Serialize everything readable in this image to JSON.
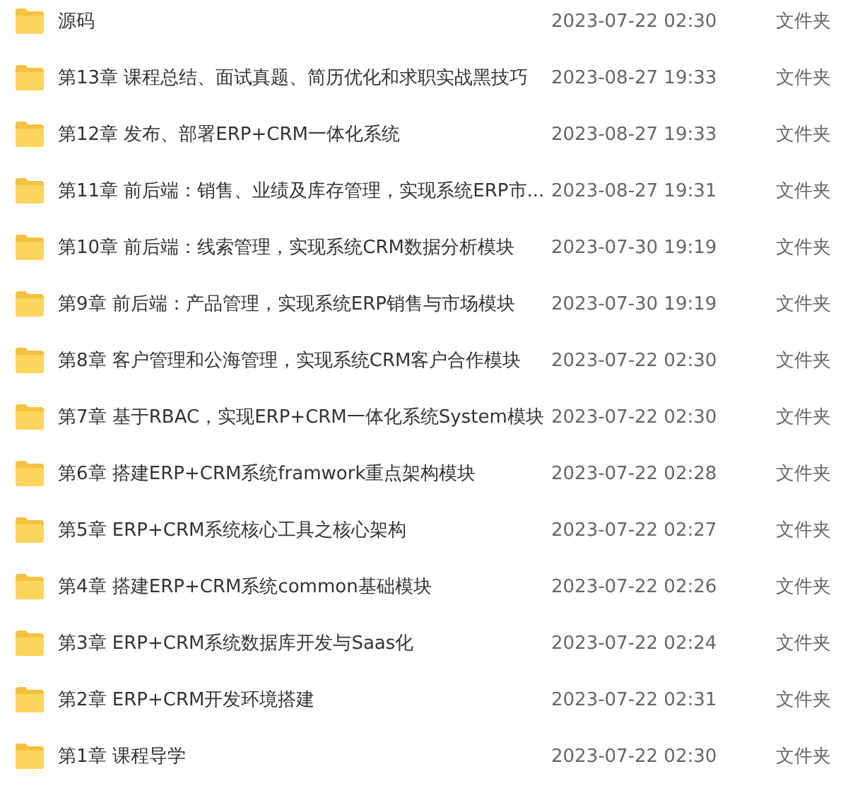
{
  "rows": [
    {
      "name": "源码",
      "modified": "2023-07-22 02:30",
      "type": "文件夹"
    },
    {
      "name": "第13章 课程总结、面试真题、简历优化和求职实战黑技巧",
      "modified": "2023-08-27 19:33",
      "type": "文件夹"
    },
    {
      "name": "第12章 发布、部署ERP+CRM一体化系统",
      "modified": "2023-08-27 19:33",
      "type": "文件夹"
    },
    {
      "name": "第11章 前后端：销售、业绩及库存管理，实现系统ERP市...",
      "modified": "2023-08-27 19:31",
      "type": "文件夹"
    },
    {
      "name": "第10章 前后端：线索管理，实现系统CRM数据分析模块",
      "modified": "2023-07-30 19:19",
      "type": "文件夹"
    },
    {
      "name": "第9章 前后端：产品管理，实现系统ERP销售与市场模块",
      "modified": "2023-07-30 19:19",
      "type": "文件夹"
    },
    {
      "name": "第8章 客户管理和公海管理，实现系统CRM客户合作模块",
      "modified": "2023-07-22 02:30",
      "type": "文件夹"
    },
    {
      "name": "第7章 基于RBAC，实现ERP+CRM一体化系统System模块",
      "modified": "2023-07-22 02:30",
      "type": "文件夹"
    },
    {
      "name": "第6章 搭建ERP+CRM系统framwork重点架构模块",
      "modified": "2023-07-22 02:28",
      "type": "文件夹"
    },
    {
      "name": "第5章 ERP+CRM系统核心工具之核心架构",
      "modified": "2023-07-22 02:27",
      "type": "文件夹"
    },
    {
      "name": "第4章 搭建ERP+CRM系统common基础模块",
      "modified": "2023-07-22 02:26",
      "type": "文件夹"
    },
    {
      "name": "第3章 ERP+CRM系统数据库开发与Saas化",
      "modified": "2023-07-22 02:24",
      "type": "文件夹"
    },
    {
      "name": "第2章 ERP+CRM开发环境搭建",
      "modified": "2023-07-22 02:31",
      "type": "文件夹"
    },
    {
      "name": "第1章 课程导学",
      "modified": "2023-07-22 02:30",
      "type": "文件夹"
    }
  ]
}
